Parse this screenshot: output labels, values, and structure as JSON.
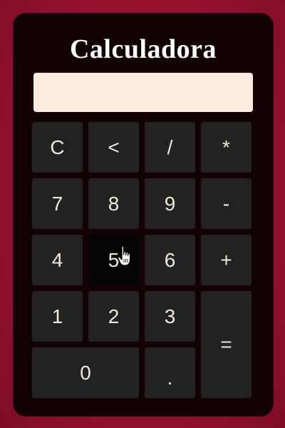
{
  "app": {
    "title": "Calculadora"
  },
  "display": {
    "value": ""
  },
  "keys": {
    "clear": "C",
    "back": "<",
    "divide": "/",
    "multiply": "*",
    "seven": "7",
    "eight": "8",
    "nine": "9",
    "minus": "-",
    "four": "4",
    "five": "5",
    "six": "6",
    "plus": "+",
    "one": "1",
    "two": "2",
    "three": "3",
    "equals": "=",
    "zero": "0",
    "dot": "."
  },
  "colors": {
    "background": "#a01433",
    "panel": "#120204",
    "key": "#222223",
    "key_hover": "#050505",
    "key_text": "#f3e7d8",
    "display": "#faebdc"
  },
  "cursor": {
    "icon": "hand-pointer-icon"
  }
}
